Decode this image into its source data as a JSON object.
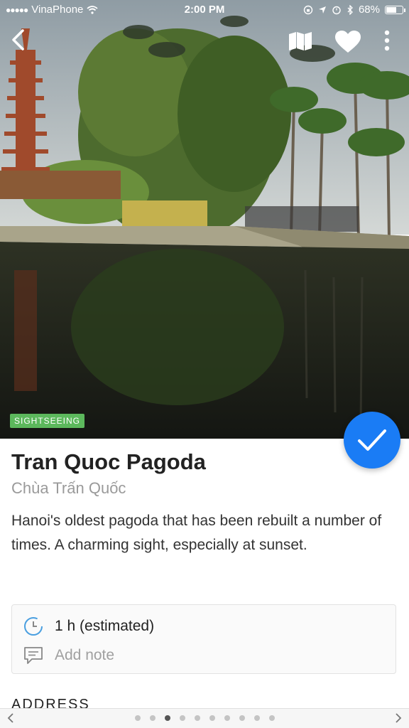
{
  "status_bar": {
    "carrier": "VinaPhone",
    "time": "2:00 PM",
    "battery": "68%",
    "battery_level": 0.68
  },
  "hero": {
    "category": "SIGHTSEEING",
    "category_color": "#5cb85c"
  },
  "place": {
    "title": "Tran Quoc Pagoda",
    "subtitle": "Chùa Trấn Quốc",
    "description": "Hanoi's oldest pagoda that has been rebuilt a number of times. A charming sight, especially at sunset."
  },
  "info_card": {
    "duration": "1 h (estimated)",
    "note_placeholder": "Add note"
  },
  "address_heading": "ADDRESS",
  "pager": {
    "total": 10,
    "active_index": 2
  },
  "colors": {
    "accent": "#1a7cf5",
    "clock_icon": "#4a9fe0"
  }
}
